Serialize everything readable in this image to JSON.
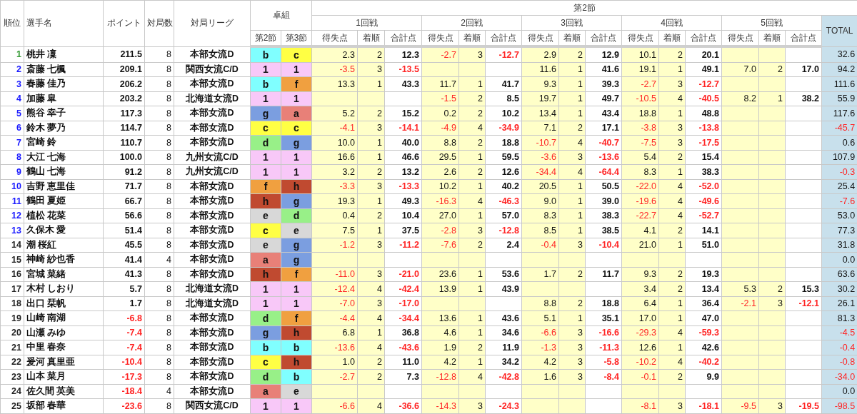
{
  "header": {
    "rank": "順位",
    "name": "選手名",
    "points": "ポイント",
    "games": "対局数",
    "league": "対局リーグ",
    "tables": "卓組",
    "table_sections": [
      "第2節",
      "第3節"
    ],
    "section": "第2節",
    "total": "TOTAL",
    "rounds": [
      {
        "title": "1回戦",
        "columns": [
          "得失点",
          "着順",
          "合計点"
        ]
      },
      {
        "title": "2回戦",
        "columns": [
          "得失点",
          "着順",
          "合計点"
        ]
      },
      {
        "title": "3回戦",
        "columns": [
          "得失点",
          "着順",
          "合計点"
        ]
      },
      {
        "title": "4回戦",
        "columns": [
          "得失点",
          "着順",
          "合計点"
        ]
      },
      {
        "title": "5回戦",
        "columns": [
          "得失点",
          "着順",
          "合計点"
        ]
      }
    ]
  },
  "players": [
    {
      "rank": "1",
      "color": "#339933",
      "name": "桃井 凜",
      "points": "211.5",
      "games": "8",
      "league": "本部女流D",
      "tables": [
        {
          "label": "b",
          "color": "#80ffff"
        },
        {
          "label": "c",
          "color": "#ffff44"
        }
      ],
      "rounds": [
        [
          "2.3",
          "2",
          "12.3"
        ],
        [
          "-2.7",
          "3",
          "-12.7"
        ],
        [
          "2.9",
          "2",
          "12.9"
        ],
        [
          "10.1",
          "2",
          "20.1"
        ],
        {
          "blank": true
        }
      ],
      "total": "32.6"
    },
    {
      "rank": "2",
      "color": "#1a1aff",
      "name": "斎藤 七楓",
      "points": "209.1",
      "games": "8",
      "league": "関西女流C/D",
      "tables": [
        {
          "label": "1",
          "color": "#f8c8f8"
        },
        {
          "label": "1",
          "color": "#f8c8f8"
        }
      ],
      "rounds": [
        [
          "-3.5",
          "3",
          "-13.5"
        ],
        {
          "blank": true
        },
        [
          "11.6",
          "1",
          "41.6"
        ],
        [
          "19.1",
          "1",
          "49.1"
        ],
        [
          "7.0",
          "2",
          "17.0"
        ]
      ],
      "total": "94.2"
    },
    {
      "rank": "3",
      "color": "#1a1aff",
      "name": "春藤 佳乃",
      "points": "206.2",
      "games": "8",
      "league": "本部女流D",
      "tables": [
        {
          "label": "b",
          "color": "#80ffff"
        },
        {
          "label": "f",
          "color": "#f0a040"
        }
      ],
      "rounds": [
        [
          "13.3",
          "1",
          "43.3"
        ],
        [
          "11.7",
          "1",
          "41.7"
        ],
        [
          "9.3",
          "1",
          "39.3"
        ],
        [
          "-2.7",
          "3",
          "-12.7"
        ],
        {
          "blank": true
        }
      ],
      "total": "111.6"
    },
    {
      "rank": "4",
      "color": "#1a1aff",
      "name": "加藤 皐",
      "points": "203.2",
      "games": "8",
      "league": "北海道女流D",
      "tables": [
        {
          "label": "1",
          "color": "#f8c8f8"
        },
        {
          "label": "1",
          "color": "#f8c8f8"
        }
      ],
      "rounds": [
        {
          "blank": true
        },
        [
          "-1.5",
          "2",
          "8.5"
        ],
        [
          "19.7",
          "1",
          "49.7"
        ],
        [
          "-10.5",
          "4",
          "-40.5"
        ],
        [
          "8.2",
          "1",
          "38.2"
        ]
      ],
      "total": "55.9"
    },
    {
      "rank": "5",
      "color": "#1a1aff",
      "name": "熊谷 幸子",
      "points": "117.3",
      "games": "8",
      "league": "本部女流D",
      "tables": [
        {
          "label": "g",
          "color": "#7b9ee0"
        },
        {
          "label": "a",
          "color": "#e88078"
        }
      ],
      "rounds": [
        [
          "5.2",
          "2",
          "15.2"
        ],
        [
          "0.2",
          "2",
          "10.2"
        ],
        [
          "13.4",
          "1",
          "43.4"
        ],
        [
          "18.8",
          "1",
          "48.8"
        ],
        {
          "blank": true
        }
      ],
      "total": "117.6"
    },
    {
      "rank": "6",
      "color": "#1a1aff",
      "name": "鈴木 夢乃",
      "points": "114.7",
      "games": "8",
      "league": "本部女流D",
      "tables": [
        {
          "label": "c",
          "color": "#ffff44"
        },
        {
          "label": "c",
          "color": "#ffff44"
        }
      ],
      "rounds": [
        [
          "-4.1",
          "3",
          "-14.1"
        ],
        [
          "-4.9",
          "4",
          "-34.9"
        ],
        [
          "7.1",
          "2",
          "17.1"
        ],
        [
          "-3.8",
          "3",
          "-13.8"
        ],
        {
          "blank": true
        }
      ],
      "total": "-45.7"
    },
    {
      "rank": "7",
      "color": "#1a1aff",
      "name": "宮崎 鈴",
      "points": "110.7",
      "games": "8",
      "league": "本部女流D",
      "tables": [
        {
          "label": "d",
          "color": "#98f088"
        },
        {
          "label": "g",
          "color": "#7b9ee0"
        }
      ],
      "rounds": [
        [
          "10.0",
          "1",
          "40.0"
        ],
        [
          "8.8",
          "2",
          "18.8"
        ],
        [
          "-10.7",
          "4",
          "-40.7"
        ],
        [
          "-7.5",
          "3",
          "-17.5"
        ],
        {
          "blank": true
        }
      ],
      "total": "0.6"
    },
    {
      "rank": "8",
      "color": "#1a1aff",
      "name": "大江 七海",
      "points": "100.0",
      "games": "8",
      "league": "九州女流C/D",
      "tables": [
        {
          "label": "1",
          "color": "#f8c8f8"
        },
        {
          "label": "1",
          "color": "#f8c8f8"
        }
      ],
      "rounds": [
        [
          "16.6",
          "1",
          "46.6"
        ],
        [
          "29.5",
          "1",
          "59.5"
        ],
        [
          "-3.6",
          "3",
          "-13.6"
        ],
        [
          "5.4",
          "2",
          "15.4"
        ],
        {
          "blank": true
        }
      ],
      "total": "107.9"
    },
    {
      "rank": "9",
      "color": "#1a1aff",
      "name": "鶴山 七海",
      "points": "91.2",
      "games": "8",
      "league": "九州女流C/D",
      "tables": [
        {
          "label": "1",
          "color": "#f8c8f8"
        },
        {
          "label": "1",
          "color": "#f8c8f8"
        }
      ],
      "rounds": [
        [
          "3.2",
          "2",
          "13.2"
        ],
        [
          "2.6",
          "2",
          "12.6"
        ],
        [
          "-34.4",
          "4",
          "-64.4"
        ],
        [
          "8.3",
          "1",
          "38.3"
        ],
        {
          "blank": true
        }
      ],
      "total": "-0.3"
    },
    {
      "rank": "10",
      "color": "#1a1aff",
      "name": "吉野 恵里佳",
      "points": "71.7",
      "games": "8",
      "league": "本部女流D",
      "tables": [
        {
          "label": "f",
          "color": "#f0a040"
        },
        {
          "label": "h",
          "color": "#c04a30"
        }
      ],
      "rounds": [
        [
          "-3.3",
          "3",
          "-13.3"
        ],
        [
          "10.2",
          "1",
          "40.2"
        ],
        [
          "20.5",
          "1",
          "50.5"
        ],
        [
          "-22.0",
          "4",
          "-52.0"
        ],
        {
          "blank": true
        }
      ],
      "total": "25.4"
    },
    {
      "rank": "11",
      "color": "#1a1aff",
      "name": "鶴田 夏姫",
      "points": "66.7",
      "games": "8",
      "league": "本部女流D",
      "tables": [
        {
          "label": "h",
          "color": "#c04a30"
        },
        {
          "label": "g",
          "color": "#7b9ee0"
        }
      ],
      "rounds": [
        [
          "19.3",
          "1",
          "49.3"
        ],
        [
          "-16.3",
          "4",
          "-46.3"
        ],
        [
          "9.0",
          "1",
          "39.0"
        ],
        [
          "-19.6",
          "4",
          "-49.6"
        ],
        {
          "blank": true
        }
      ],
      "total": "-7.6"
    },
    {
      "rank": "12",
      "color": "#1a1aff",
      "name": "植松 花菜",
      "points": "56.6",
      "games": "8",
      "league": "本部女流D",
      "tables": [
        {
          "label": "e",
          "color": "#d8d8d8"
        },
        {
          "label": "d",
          "color": "#98f088"
        }
      ],
      "rounds": [
        [
          "0.4",
          "2",
          "10.4"
        ],
        [
          "27.0",
          "1",
          "57.0"
        ],
        [
          "8.3",
          "1",
          "38.3"
        ],
        [
          "-22.7",
          "4",
          "-52.7"
        ],
        {
          "blank": true
        }
      ],
      "total": "53.0"
    },
    {
      "rank": "13",
      "color": "#1a1aff",
      "name": "久保木 愛",
      "points": "51.4",
      "games": "8",
      "league": "本部女流D",
      "tables": [
        {
          "label": "c",
          "color": "#ffff44"
        },
        {
          "label": "e",
          "color": "#d8d8d8"
        }
      ],
      "rounds": [
        [
          "7.5",
          "1",
          "37.5"
        ],
        [
          "-2.8",
          "3",
          "-12.8"
        ],
        [
          "8.5",
          "1",
          "38.5"
        ],
        [
          "4.1",
          "2",
          "14.1"
        ],
        {
          "blank": true
        }
      ],
      "total": "77.3"
    },
    {
      "rank": "14",
      "color": "#222222",
      "name": "潮 桜紅",
      "points": "45.5",
      "games": "8",
      "league": "本部女流D",
      "tables": [
        {
          "label": "e",
          "color": "#d8d8d8"
        },
        {
          "label": "g",
          "color": "#7b9ee0"
        }
      ],
      "rounds": [
        [
          "-1.2",
          "3",
          "-11.2"
        ],
        [
          "-7.6",
          "2",
          "2.4"
        ],
        [
          "-0.4",
          "3",
          "-10.4"
        ],
        [
          "21.0",
          "1",
          "51.0"
        ],
        {
          "blank": true
        }
      ],
      "total": "31.8"
    },
    {
      "rank": "15",
      "color": "#222222",
      "name": "神崎 紗也香",
      "points": "41.4",
      "games": "4",
      "league": "本部女流D",
      "tables": [
        {
          "label": "a",
          "color": "#e88078"
        },
        {
          "label": "g",
          "color": "#7b9ee0"
        }
      ],
      "rounds": [
        {
          "blank": true
        },
        {
          "blank": true
        },
        {
          "blank": true
        },
        {
          "blank": true
        },
        {
          "blank": true
        }
      ],
      "total": "0.0"
    },
    {
      "rank": "16",
      "color": "#222222",
      "name": "宮城 菜緒",
      "points": "41.3",
      "games": "8",
      "league": "本部女流D",
      "tables": [
        {
          "label": "h",
          "color": "#c04a30"
        },
        {
          "label": "f",
          "color": "#f0a040"
        }
      ],
      "rounds": [
        [
          "-11.0",
          "3",
          "-21.0"
        ],
        [
          "23.6",
          "1",
          "53.6"
        ],
        [
          "1.7",
          "2",
          "11.7"
        ],
        [
          "9.3",
          "2",
          "19.3"
        ],
        {
          "blank": true
        }
      ],
      "total": "63.6"
    },
    {
      "rank": "17",
      "color": "#222222",
      "name": "木村 しおり",
      "points": "5.7",
      "games": "8",
      "league": "北海道女流D",
      "tables": [
        {
          "label": "1",
          "color": "#f8c8f8"
        },
        {
          "label": "1",
          "color": "#f8c8f8"
        }
      ],
      "rounds": [
        [
          "-12.4",
          "4",
          "-42.4"
        ],
        [
          "13.9",
          "1",
          "43.9"
        ],
        {
          "blank": true
        },
        [
          "3.4",
          "2",
          "13.4"
        ],
        [
          "5.3",
          "2",
          "15.3"
        ]
      ],
      "total": "30.2"
    },
    {
      "rank": "18",
      "color": "#222222",
      "name": "出口 栞帆",
      "points": "1.7",
      "games": "8",
      "league": "北海道女流D",
      "tables": [
        {
          "label": "1",
          "color": "#f8c8f8"
        },
        {
          "label": "1",
          "color": "#f8c8f8"
        }
      ],
      "rounds": [
        [
          "-7.0",
          "3",
          "-17.0"
        ],
        {
          "blank": true
        },
        [
          "8.8",
          "2",
          "18.8"
        ],
        [
          "6.4",
          "1",
          "36.4"
        ],
        [
          "-2.1",
          "3",
          "-12.1"
        ]
      ],
      "total": "26.1"
    },
    {
      "rank": "19",
      "color": "#222222",
      "name": "山崎 南湖",
      "points": "-6.8",
      "games": "8",
      "league": "本部女流D",
      "tables": [
        {
          "label": "d",
          "color": "#98f088"
        },
        {
          "label": "f",
          "color": "#f0a040"
        }
      ],
      "rounds": [
        [
          "-4.4",
          "4",
          "-34.4"
        ],
        [
          "13.6",
          "1",
          "43.6"
        ],
        [
          "5.1",
          "1",
          "35.1"
        ],
        [
          "17.0",
          "1",
          "47.0"
        ],
        {
          "blank": true
        }
      ],
      "total": "81.3"
    },
    {
      "rank": "20",
      "color": "#222222",
      "name": "山瀬 みゆ",
      "points": "-7.4",
      "games": "8",
      "league": "本部女流D",
      "tables": [
        {
          "label": "g",
          "color": "#7b9ee0"
        },
        {
          "label": "h",
          "color": "#c04a30"
        }
      ],
      "rounds": [
        [
          "6.8",
          "1",
          "36.8"
        ],
        [
          "4.6",
          "1",
          "34.6"
        ],
        [
          "-6.6",
          "3",
          "-16.6"
        ],
        [
          "-29.3",
          "4",
          "-59.3"
        ],
        {
          "blank": true
        }
      ],
      "total": "-4.5"
    },
    {
      "rank": "21",
      "color": "#222222",
      "name": "中里 春奈",
      "points": "-7.4",
      "games": "8",
      "league": "本部女流D",
      "tables": [
        {
          "label": "b",
          "color": "#80ffff"
        },
        {
          "label": "b",
          "color": "#80ffff"
        }
      ],
      "rounds": [
        [
          "-13.6",
          "4",
          "-43.6"
        ],
        [
          "1.9",
          "2",
          "11.9"
        ],
        [
          "-1.3",
          "3",
          "-11.3"
        ],
        [
          "12.6",
          "1",
          "42.6"
        ],
        {
          "blank": true
        }
      ],
      "total": "-0.4"
    },
    {
      "rank": "22",
      "color": "#222222",
      "name": "爰河 真里亜",
      "points": "-10.4",
      "games": "8",
      "league": "本部女流D",
      "tables": [
        {
          "label": "c",
          "color": "#ffff44"
        },
        {
          "label": "h",
          "color": "#c04a30"
        }
      ],
      "rounds": [
        [
          "1.0",
          "2",
          "11.0"
        ],
        [
          "4.2",
          "1",
          "34.2"
        ],
        [
          "4.2",
          "3",
          "-5.8"
        ],
        [
          "-10.2",
          "4",
          "-40.2"
        ],
        {
          "blank": true
        }
      ],
      "total": "-0.8"
    },
    {
      "rank": "23",
      "color": "#222222",
      "name": "山本 菜月",
      "points": "-17.3",
      "games": "8",
      "league": "本部女流D",
      "tables": [
        {
          "label": "d",
          "color": "#98f088"
        },
        {
          "label": "b",
          "color": "#80ffff"
        }
      ],
      "rounds": [
        [
          "-2.7",
          "2",
          "7.3"
        ],
        [
          "-12.8",
          "4",
          "-42.8"
        ],
        [
          "1.6",
          "3",
          "-8.4"
        ],
        [
          "-0.1",
          "2",
          "9.9"
        ],
        {
          "blank": true
        }
      ],
      "total": "-34.0"
    },
    {
      "rank": "24",
      "color": "#222222",
      "name": "佐久間 英美",
      "points": "-18.4",
      "games": "4",
      "league": "本部女流D",
      "tables": [
        {
          "label": "a",
          "color": "#e88078"
        },
        {
          "label": "e",
          "color": "#d8d8d8"
        }
      ],
      "rounds": [
        {
          "blank": true
        },
        {
          "blank": true
        },
        {
          "blank": true
        },
        {
          "blank": true
        },
        {
          "blank": true
        }
      ],
      "total": "0.0"
    },
    {
      "rank": "25",
      "color": "#222222",
      "name": "坂部 春華",
      "points": "-23.6",
      "games": "8",
      "league": "関西女流C/D",
      "tables": [
        {
          "label": "1",
          "color": "#f8c8f8"
        },
        {
          "label": "1",
          "color": "#f8c8f8"
        }
      ],
      "rounds": [
        [
          "-6.6",
          "4",
          "-36.6"
        ],
        [
          "-14.3",
          "3",
          "-24.3"
        ],
        {
          "blank": true
        },
        [
          "-8.1",
          "3",
          "-18.1"
        ],
        [
          "-9.5",
          "3",
          "-19.5"
        ]
      ],
      "total": "-98.5"
    }
  ]
}
